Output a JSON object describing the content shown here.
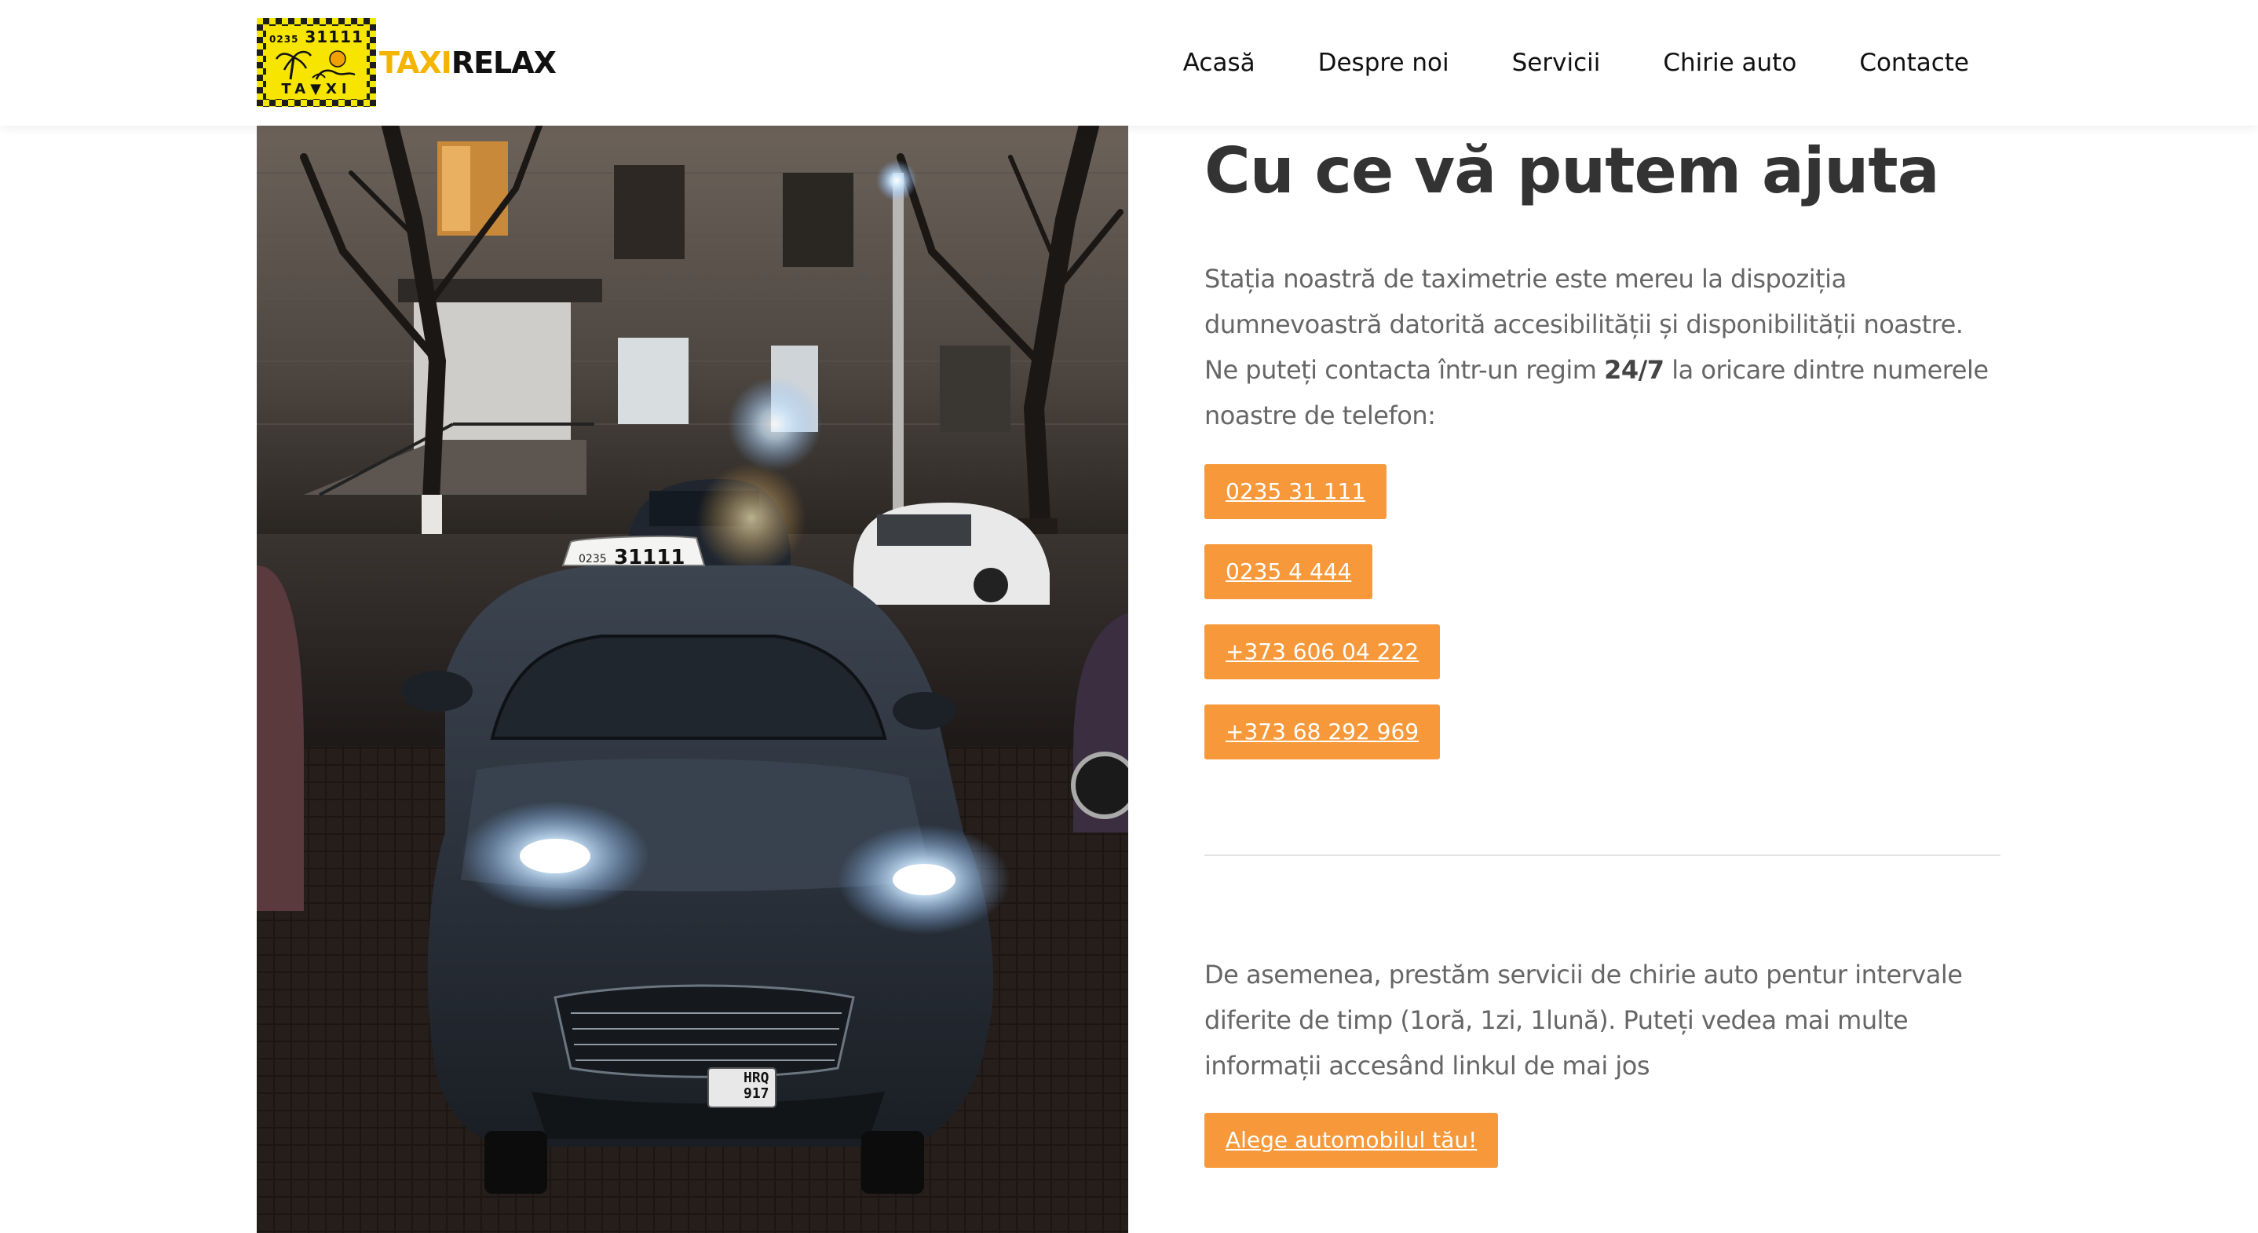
{
  "header": {
    "logo": {
      "badge_phone_prefix": "0235",
      "badge_phone": "31111",
      "badge_word": "TA▼XI",
      "brand_taxi": "TAXI",
      "brand_relax": "RELAX"
    },
    "nav": [
      {
        "label": "Acasă"
      },
      {
        "label": "Despre noi"
      },
      {
        "label": "Servicii"
      },
      {
        "label": "Chirie auto"
      },
      {
        "label": "Contacte"
      }
    ]
  },
  "photo": {
    "roof_sign_prefix": "0235",
    "roof_sign_number": "31111",
    "plate_line1": "HRQ",
    "plate_line2": "917"
  },
  "main": {
    "title": "Cu ce vă putem ajuta",
    "intro_part1": "Stația noastră de taximetrie este mereu la dispoziția dumnevoastră datorită accesibilității și disponibilității noastre. Ne puteți contacta într-un regim ",
    "intro_bold": "24/7",
    "intro_part2": " la oricare dintre numerele noastre de telefon:",
    "phones": [
      {
        "label": "0235 31 111"
      },
      {
        "label": "0235 4 444"
      },
      {
        "label": "+373 606 04 222"
      },
      {
        "label": "+373 68 292 969"
      }
    ],
    "rental_text": "De asemenea, prestăm servicii de chirie auto pentur intervale diferite de timp (1oră, 1zi, 1lună). Puteți vedea mai multe informații accesând linkul de mai jos",
    "cta_label": "Alege automobilul tău!"
  },
  "colors": {
    "accent": "#f7993a",
    "brand_yellow": "#f4b400",
    "heading": "#333333",
    "body_text": "#666666"
  }
}
